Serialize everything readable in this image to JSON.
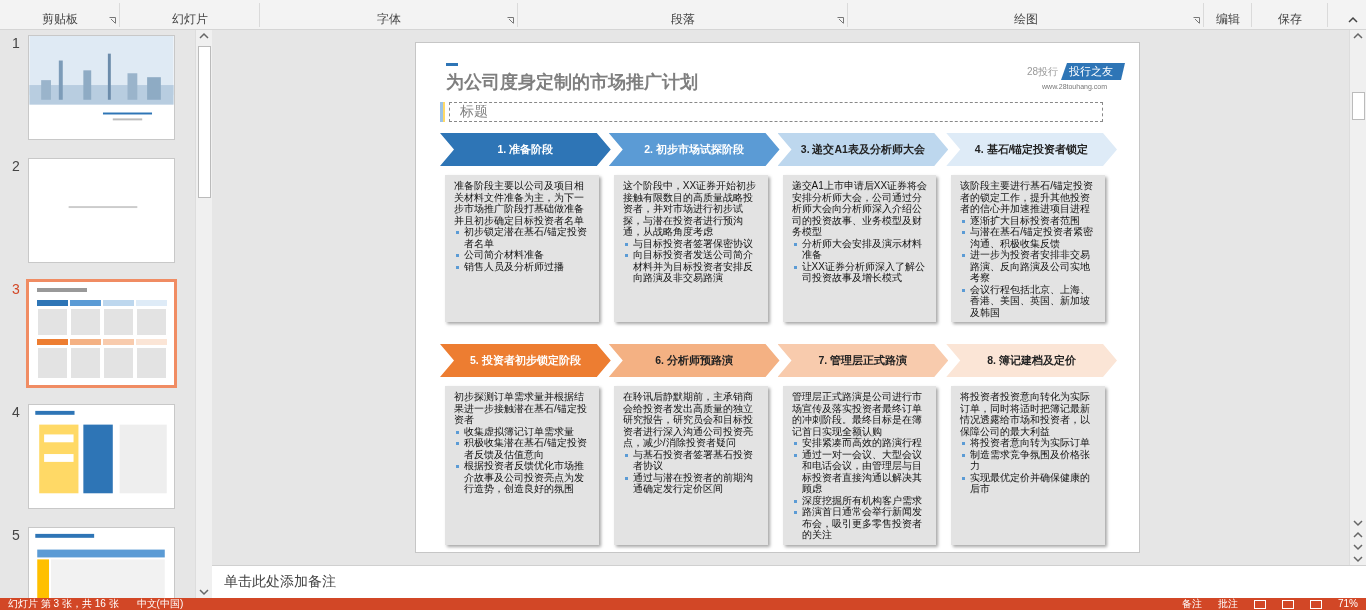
{
  "ribbon": {
    "groups": [
      {
        "label": "剪贴板",
        "launcher": true
      },
      {
        "label": "幻灯片",
        "launcher": false
      },
      {
        "label": "字体",
        "launcher": true
      },
      {
        "label": "段落",
        "launcher": true
      },
      {
        "label": "绘图",
        "launcher": true
      },
      {
        "label": "编辑",
        "launcher": false
      },
      {
        "label": "保存",
        "launcher": false
      }
    ]
  },
  "thumbnails": [
    {
      "number": "1",
      "kind": "cover",
      "selected": false
    },
    {
      "number": "2",
      "kind": "blank",
      "selected": false
    },
    {
      "number": "3",
      "kind": "stages",
      "selected": true
    },
    {
      "number": "4",
      "kind": "flow",
      "selected": false
    },
    {
      "number": "5",
      "kind": "table",
      "selected": false
    }
  ],
  "slide": {
    "title": "为公司度身定制的市场推广计划",
    "placeholder": "标题",
    "logo": {
      "brand": "28投行",
      "tag": "投行之友",
      "url": "www.28touhang.com"
    },
    "stages": [
      {
        "title": "1. 准备阶段",
        "color": "#2e75b6",
        "intro": "准备阶段主要以公司及项目相关材料文件准备为主，为下一步市场推广阶段打基础做准备并且初步确定目标投资者名单",
        "bullets": [
          "初步锁定潜在基石/锚定投资者名单",
          "公司简介材料准备",
          "销售人员及分析师过播"
        ]
      },
      {
        "title": "2. 初步市场试探阶段",
        "color": "#5b9bd5",
        "intro": "这个阶段中，XX证券开始初步接触有限数目的高质量战略投资者，并对市场进行初步试探，与潜在投资者进行预沟通，从战略角度考虑",
        "bullets": [
          "与目标投资者签署保密协议",
          "向目标投资者发送公司简介材料并为目标投资者安排反向路演及非交易路演"
        ]
      },
      {
        "title": "3. 递交A1表及分析师大会",
        "color": "#bdd7ee",
        "intro": "递交A1上市申请后XX证券将会安排分析师大会，公司通过分析师大会向分析师深入介绍公司的投资故事、业务模型及财务模型",
        "bullets": [
          "分析师大会安排及演示材料准备",
          "让XX证券分析师深入了解公司投资故事及增长模式"
        ]
      },
      {
        "title": "4. 基石/锚定投资者锁定",
        "color": "#deebf7",
        "intro": "该阶段主要进行基石/锚定投资者的锁定工作，提升其他投资者的信心并加速推进项目进程",
        "bullets": [
          "逐渐扩大目标投资者范围",
          "与潜在基石/锚定投资者紧密沟通、积极收集反馈",
          "进一步为投资者安排非交易路演、反向路演及公司实地考察",
          "会议行程包括北京、上海、香港、美国、英国、新加坡及韩国"
        ]
      },
      {
        "title": "5. 投资者初步锁定阶段",
        "color": "#ed7d31",
        "intro": "初步探测订单需求量并根据结果进一步接触潜在基石/锚定投资者",
        "bullets": [
          "收集虚拟簿记订单需求量",
          "积极收集潜在基石/锚定投资者反馈及估值意向",
          "根据投资者反馈优化市场推介故事及公司投资亮点为发行造势，创造良好的氛围"
        ]
      },
      {
        "title": "6. 分析师预路演",
        "color": "#f4b183",
        "intro": "在聆讯后静默期前，主承销商会给投资者发出高质量的独立研究报告，研究员会和目标投资者进行深入沟通公司投资亮点，减少/消除投资者疑问",
        "bullets": [
          "与基石投资者签署基石投资者协议",
          "通过与潜在投资者的前期沟通确定发行定价区间"
        ]
      },
      {
        "title": "7. 管理层正式路演",
        "color": "#f8cbad",
        "intro": "管理层正式路演是公司进行市场宣传及落实投资者最终订单的冲刺阶段。最终目标是在簿记首日实现全额认购",
        "bullets": [
          "安排紧凑而高效的路演行程",
          "通过一对一会议、大型会议和电话会议，由管理层与目标投资者直接沟通以解决其顾虑",
          "深度挖掘所有机构客户需求",
          "路演首日通常会举行新闻发布会，吸引更多零售投资者的关注"
        ]
      },
      {
        "title": "8. 簿记建档及定价",
        "color": "#fbe5d6",
        "intro": "将投资者投资意向转化为实际订单，同时将适时把簿记最新情况透露给市场和投资者，以保障公司的最大利益",
        "bullets": [
          "将投资者意向转为实际订单",
          "制造需求竞争氛围及价格张力",
          "实现最优定价并确保健康的后市"
        ]
      }
    ]
  },
  "notes": {
    "placeholder": "单击此处添加备注"
  },
  "status_bar": {
    "slide_info": "幻灯片 第 3 张，共 16 张",
    "language": "中文(中国)",
    "notes": "备注",
    "comments": "批注",
    "zoom": "71%"
  }
}
